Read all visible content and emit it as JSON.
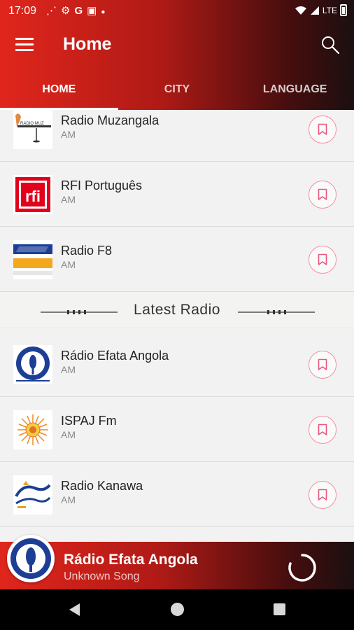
{
  "status_bar": {
    "time": "17:09",
    "network": "LTE"
  },
  "toolbar": {
    "title": "Home"
  },
  "tabs": [
    {
      "label": "HOME",
      "active": true
    },
    {
      "label": "CITY",
      "active": false
    },
    {
      "label": "LANGUAGE",
      "active": false
    }
  ],
  "stations": [
    {
      "name": "Radio Muzangala",
      "band": "AM",
      "logo_icon": "radio-muzangala-logo"
    },
    {
      "name": "RFI Português",
      "band": "AM",
      "logo_icon": "rfi-logo",
      "logo_text": "rfi"
    },
    {
      "name": "Radio F8",
      "band": "AM",
      "logo_icon": "radio-f8-logo"
    }
  ],
  "latest_section": {
    "title": "Latest Radio"
  },
  "latest_stations": [
    {
      "name": "Rádio Efata Angola",
      "band": "AM",
      "logo_icon": "radio-efata-logo"
    },
    {
      "name": "ISPAJ Fm",
      "band": "AM",
      "logo_icon": "ispaj-sun-logo"
    },
    {
      "name": "Radio Kanawa",
      "band": "AM",
      "logo_icon": "radio-kanawa-logo"
    }
  ],
  "player": {
    "station": "Rádio Efata Angola",
    "song": "Unknown Song",
    "state": "loading"
  },
  "colors": {
    "header_start": "#e0261c",
    "header_end": "#1b0f10",
    "bookmark_accent": "#e85a7a"
  }
}
